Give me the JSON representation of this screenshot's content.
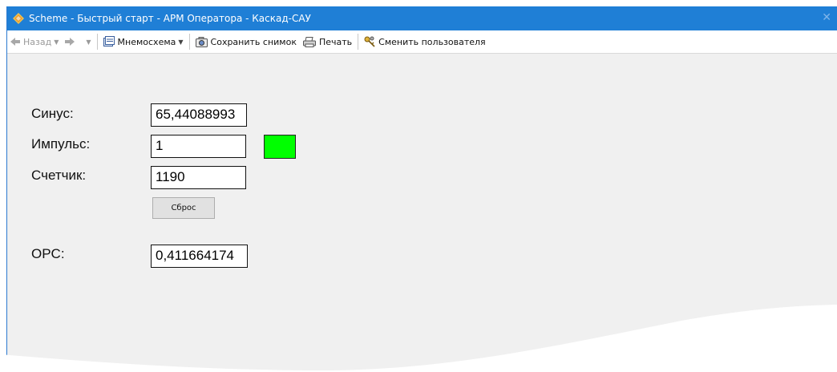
{
  "window": {
    "title": "Scheme - Быстрый старт - АРМ Оператора - Каскад-САУ"
  },
  "toolbar": {
    "back_label": "Назад",
    "mnemo_label": "Мнемосхема",
    "snapshot_label": "Сохранить снимок",
    "print_label": "Печать",
    "switch_user_label": "Сменить пользователя"
  },
  "scheme": {
    "sine_label": "Синус:",
    "sine_value": "65,44088993",
    "pulse_label": "Импульс:",
    "pulse_value": "1",
    "pulse_indicator_color": "#00ff00",
    "counter_label": "Счетчик:",
    "counter_value": "1190",
    "reset_label": "Сброс",
    "opc_label": "OPC:",
    "opc_value": "0,411664174"
  }
}
